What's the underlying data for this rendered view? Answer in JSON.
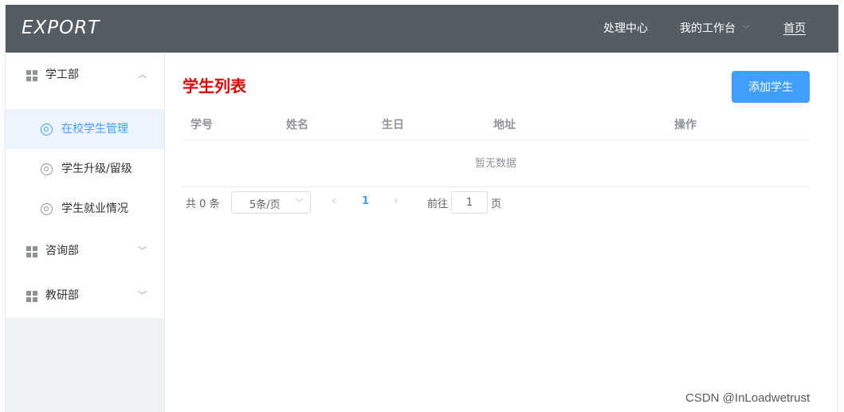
{
  "header": {
    "logo": "EXPORT",
    "nav": {
      "processing_center": "处理中心",
      "my_workbench": "我的工作台",
      "home": "首页"
    }
  },
  "sidebar": {
    "groups": [
      {
        "label": "学工部",
        "expanded": true,
        "items": [
          {
            "label": "在校学生管理",
            "active": true
          },
          {
            "label": "学生升级/留级",
            "active": false
          },
          {
            "label": "学生就业情况",
            "active": false
          }
        ]
      },
      {
        "label": "咨询部",
        "expanded": false
      },
      {
        "label": "教研部",
        "expanded": false
      }
    ]
  },
  "main": {
    "title": "学生列表",
    "add_button": "添加学生",
    "table": {
      "columns": [
        "学号",
        "姓名",
        "生日",
        "地址",
        "操作"
      ],
      "rows": [],
      "empty_text": "暂无数据"
    },
    "pagination": {
      "total": "共 0 条",
      "page_size": "5条/页",
      "current_page": "1",
      "goto_label": "前往",
      "goto_value": "1",
      "page_suffix": "页"
    }
  },
  "watermark": "CSDN @InLoadwetrust",
  "colors": {
    "header_bg": "#545c64",
    "accent": "#409eff",
    "title_red": "#e30000",
    "active_bg": "#ecf5ff"
  }
}
